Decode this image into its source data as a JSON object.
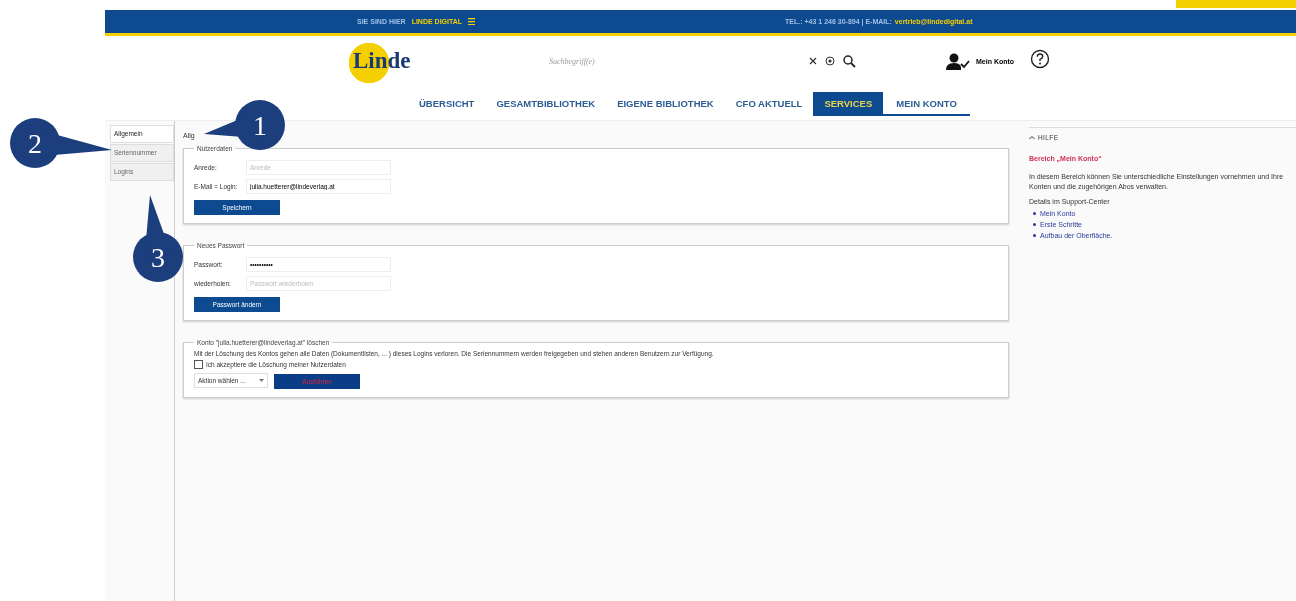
{
  "top_bar": {
    "location_label": "SIE SIND HIER",
    "site_menu": "LINDE DIGITAL",
    "contact": "TEL.: +43 1 246 30-894  |  E-MAIL:",
    "email": "vertrieb@lindedigital.at"
  },
  "header": {
    "logo": "Linde",
    "search": {
      "placeholder": "Suchbegriff(e)"
    },
    "account_label": "Mein Konto"
  },
  "nav_tabs": [
    {
      "label": "ÜBERSICHT",
      "selected": false,
      "current": false
    },
    {
      "label": "GESAMTBIBLIOTHEK",
      "selected": false,
      "current": false
    },
    {
      "label": "EIGENE BIBLIOTHEK",
      "selected": false,
      "current": false
    },
    {
      "label": "CFO AKTUELL",
      "selected": false,
      "current": false
    },
    {
      "label": "SERVICES",
      "selected": true,
      "current": false
    },
    {
      "label": "MEIN KONTO",
      "selected": false,
      "current": true
    }
  ],
  "sidebar": {
    "items": [
      {
        "label": "Allgemein",
        "selected": true
      },
      {
        "label": "Seriennummer",
        "selected": false
      },
      {
        "label": "Logins",
        "selected": false
      }
    ]
  },
  "page_title": "Allg",
  "user_data": {
    "legend": "Nutzerdaten",
    "fields": [
      {
        "label": "Anrede:",
        "placeholder": "Anrede"
      },
      {
        "label": "E-Mail = Login:",
        "value": "julia.huetterer@lindeverlag.at"
      }
    ],
    "button": "Speichern"
  },
  "new_password": {
    "legend": "Neues Passwort",
    "fields": [
      {
        "label": "Passwort:",
        "value": "••••••••••"
      },
      {
        "label": "wiederholen:",
        "placeholder": "Passwort wiederholen"
      }
    ],
    "button": "Passwort ändern"
  },
  "delete_account": {
    "legend": "Konto \"julia.huetterer@lindeverlag.at\" löschen",
    "text": "Mit der Löschung des Kontos gehen alle Daten (Dokumentlisten, ... ) dieses Logins verloren. Die Seriennummern werden freigegeben und stehen anderen Benutzern zur Verfügung.",
    "checkbox": {
      "label": "Ich akzeptiere die Löschung meiner Nutzerdaten",
      "checked": false
    },
    "action_select": "Aktion wählen ...",
    "button": "Ausführen"
  },
  "help": {
    "toggle": "HILFE",
    "expanded": true,
    "title": "Bereich „Mein Konto“",
    "text": "In diesem Bereich können Sie unterschiedliche Einstellungen vornehmen und Ihre Konten und die zugehörigen Abos verwalten.",
    "details_label": "Details im Support-Center",
    "links": [
      "Mein Konto",
      "Erste Schritte",
      "Aufbau der Oberfläche."
    ]
  },
  "callouts": [
    {
      "number": "1"
    },
    {
      "number": "2"
    },
    {
      "number": "3"
    }
  ]
}
